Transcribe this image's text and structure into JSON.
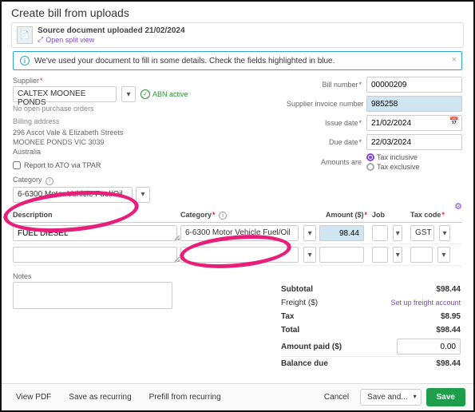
{
  "title": "Create bill from uploads",
  "source": {
    "uploaded": "Source document uploaded 21/02/2024",
    "split": "Open split view"
  },
  "alert": "We've used your document to fill in some details. Check the fields highlighted in blue.",
  "supplier": {
    "label": "Supplier",
    "value": "CALTEX MOONEE PONDS",
    "abn": "ABN active",
    "noPO": "No open purchase orders",
    "addrLabel": "Billing address",
    "addr1": "296 Ascot Vale & Elizabeth Streets",
    "addr2": "MOONEE PONDS VIC 3039",
    "addr3": "Australia",
    "tpar": "Report to ATO via TPAR"
  },
  "billNo": {
    "label": "Bill number",
    "value": "00000209"
  },
  "supInv": {
    "label": "Supplier invoice number",
    "value": "985258"
  },
  "issue": {
    "label": "Issue date",
    "value": "21/02/2024"
  },
  "due": {
    "label": "Due date",
    "value": "22/03/2024"
  },
  "amounts": {
    "label": "Amounts are",
    "inc": "Tax inclusive",
    "exc": "Tax exclusive"
  },
  "category": {
    "label": "Category",
    "value": "6-6300  Motor Vehicle Fuel/Oil"
  },
  "cols": {
    "desc": "Description",
    "cat": "Category",
    "amt": "Amount ($)",
    "job": "Job",
    "tax": "Tax code"
  },
  "lines": [
    {
      "desc": "FUEL DIESEL",
      "cat": "6-6300  Motor Vehicle Fuel/Oil",
      "amt": "98.44",
      "job": "",
      "tax": "GST"
    }
  ],
  "notesLabel": "Notes",
  "totals": {
    "subtotal_l": "Subtotal",
    "subtotal": "$98.44",
    "freight_l": "Freight ($)",
    "freight_link": "Set up freight account",
    "tax_l": "Tax",
    "tax": "$8.95",
    "total_l": "Total",
    "total": "$98.44",
    "paid_l": "Amount paid ($)",
    "paid": "0.00",
    "bal_l": "Balance due",
    "bal": "$98.44"
  },
  "footer": {
    "viewpdf": "View PDF",
    "recur": "Save as recurring",
    "prefill": "Prefill from recurring",
    "cancel": "Cancel",
    "saveand": "Save and...",
    "save": "Save"
  }
}
